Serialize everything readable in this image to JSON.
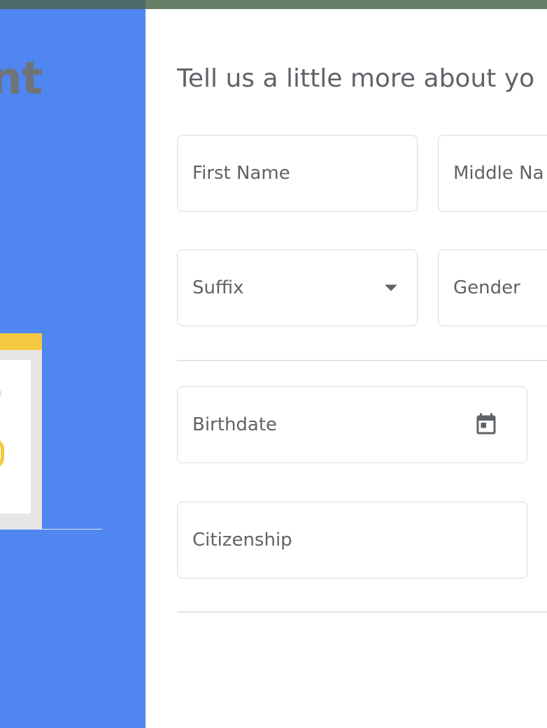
{
  "sidebar": {
    "heading_fragment": "nt"
  },
  "form": {
    "title": "Tell us a little more about yo",
    "fields": {
      "first_name": {
        "label": "First Name"
      },
      "middle_name": {
        "label": "Middle Na"
      },
      "suffix": {
        "label": "Suffix",
        "icon": "caret-down-icon"
      },
      "gender": {
        "label": "Gender"
      },
      "birthdate": {
        "label": "Birthdate",
        "icon": "calendar-icon"
      },
      "citizenship": {
        "label": "Citizenship"
      }
    }
  },
  "colors": {
    "sidebar": "#4f86ef",
    "top_bar": "#687d66",
    "accent_yellow": "#f5c842",
    "field_border": "#dcdcdc",
    "text": "#5f6368"
  }
}
